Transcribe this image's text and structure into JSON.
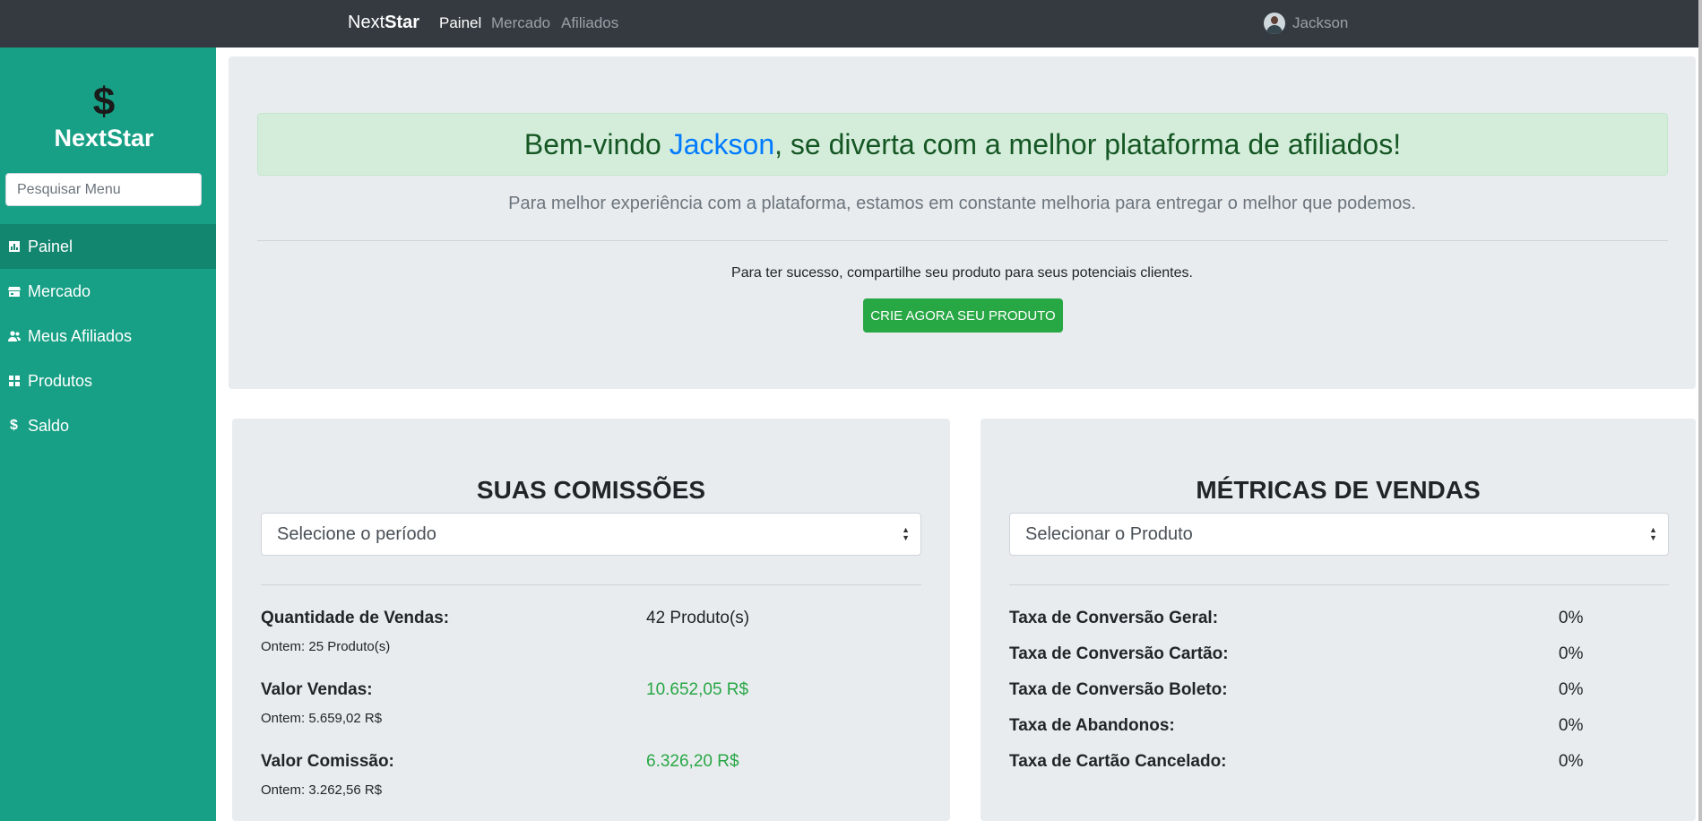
{
  "topnav": {
    "brand_light": "Next",
    "brand_bold": "Star",
    "links": [
      "Painel",
      "Mercado",
      "Afiliados"
    ],
    "user_name": "Jackson"
  },
  "sidebar": {
    "logo_symbol": "$",
    "logo_text": "NextStar",
    "search_placeholder": "Pesquisar Menu",
    "items": [
      {
        "label": "Painel",
        "icon": "bar-chart-icon",
        "active": true
      },
      {
        "label": "Mercado",
        "icon": "store-icon"
      },
      {
        "label": "Meus Afiliados",
        "icon": "users-icon"
      },
      {
        "label": "Produtos",
        "icon": "products-icon"
      },
      {
        "label": "Saldo",
        "icon": "dollar-icon"
      }
    ]
  },
  "welcome": {
    "prefix": "Bem-vindo ",
    "name": "Jackson",
    "suffix": ", se diverta com a melhor plataforma de afiliados!",
    "lead": "Para melhor experiência com a plataforma, estamos em constante melhoria para entregar o melhor que podemos.",
    "cta_text": "Para ter sucesso, compartilhe seu produto para seus potenciais clientes.",
    "cta_button": "CRIE AGORA SEU PRODUTO"
  },
  "commissions": {
    "title": "SUAS COMISSÕES",
    "select_value": "Selecione o período",
    "rows": [
      {
        "label": "Quantidade de Vendas:",
        "value": "42 Produto(s)",
        "sub": "Ontem: 25 Produto(s)"
      },
      {
        "label": "Valor Vendas:",
        "value": "10.652,05 R$",
        "sub": "Ontem: 5.659,02 R$"
      },
      {
        "label": "Valor Comissão:",
        "value": "6.326,20 R$",
        "sub": "Ontem: 3.262,56 R$"
      }
    ]
  },
  "metrics": {
    "title": "MÉTRICAS DE VENDAS",
    "select_value": "Selecionar o Produto",
    "rows": [
      {
        "label": "Taxa de Conversão Geral:",
        "value": "0%"
      },
      {
        "label": "Taxa de Conversão Cartão:",
        "value": "0%"
      },
      {
        "label": "Taxa de Conversão Boleto:",
        "value": "0%"
      },
      {
        "label": "Taxa de Abandonos:",
        "value": "0%"
      },
      {
        "label": "Taxa de Cartão Cancelado:",
        "value": "0%"
      }
    ]
  },
  "colors": {
    "navbar": "#343a40",
    "sidebar": "#17a085",
    "sidebar_active": "#12866f",
    "success": "#28a745",
    "link": "#007bff"
  }
}
